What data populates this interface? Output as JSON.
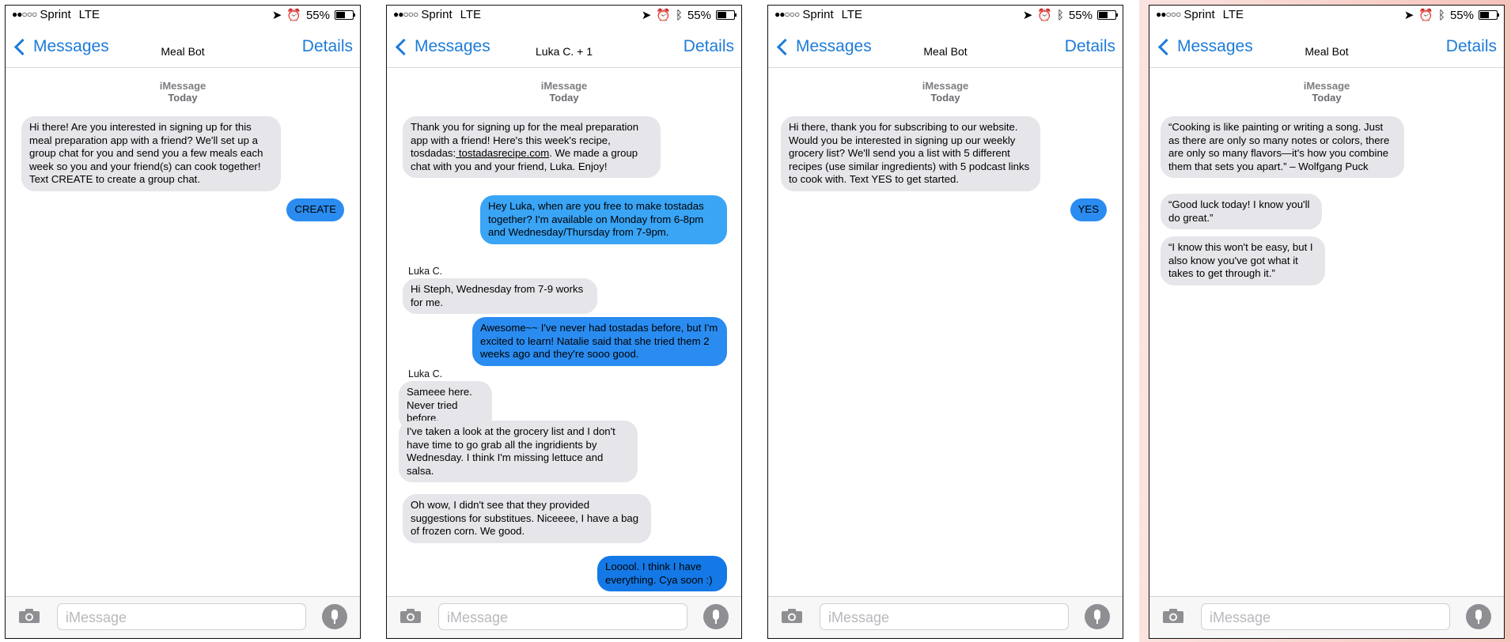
{
  "status": {
    "carrier": "Sprint",
    "network": "LTE",
    "battery": "55%"
  },
  "common": {
    "back_label": "Messages",
    "details_label": "Details",
    "service": "iMessage",
    "day": "Today",
    "input_placeholder": "iMessage"
  },
  "phones": [
    {
      "title": "Meal Bot",
      "messages": [
        {
          "text": "Hi there! Are you interested in signing up for this meal preparation app with a friend? We'll set up a group chat for you and send you a few meals each week so you and your friend(s) can cook together! Text CREATE to create a group chat."
        },
        {
          "text": "CREATE"
        }
      ]
    },
    {
      "title": "Luka C. + 1",
      "messages": [
        {
          "text_before": "Thank you for signing up for the meal preparation app with a friend! Here's this week's recipe, tosdadas:",
          "link": " tostadasrecipe.com",
          "text_after": ". We made a group chat with you and your friend, Luka. Enjoy!"
        },
        {
          "text": "Hey Luka, when are you free to make tostadas together? I'm available on Monday from 6-8pm and Wednesday/Thursday from 7-9pm."
        },
        {
          "sender": "Luka C.",
          "text": "Hi Steph, Wednesday from 7-9 works for me."
        },
        {
          "text": "Awesome~~ I've never had tostadas before, but I'm excited to learn! Natalie said that she tried them 2 weeks ago and they're sooo good."
        },
        {
          "sender": "Luka C.",
          "text": "Sameee here. Never tried before."
        },
        {
          "text": "I've taken a look at the grocery list and I don't have time to go grab all the ingridients by Wednesday. I think I'm missing lettuce and salsa."
        },
        {
          "text": "Oh wow, I didn't see that they provided suggestions for substitues. Niceeee, I have a bag of frozen corn. We good."
        },
        {
          "text": "Looool. I think I have everything. Cya soon :)"
        }
      ]
    },
    {
      "title": "Meal Bot",
      "messages": [
        {
          "text": "Hi there, thank you for subscribing to our website. Would you be interested in signing up our weekly grocery list? We'll send you a list with 5 different recipes (use similar ingredients) with 5 podcast links to cook with. Text YES to get started."
        },
        {
          "text": "YES"
        }
      ]
    },
    {
      "title": "Meal Bot",
      "messages": [
        {
          "text": "“Cooking is like painting or writing a song. Just as there are only so many notes or colors, there are only so many flavors—it's how you combine them that sets you apart.” – Wolfgang Puck"
        },
        {
          "text": "“Good luck today! I know you'll do great.”"
        },
        {
          "text": "“I know this won't be easy, but I also know you've got what it takes to get through it.”"
        }
      ]
    }
  ],
  "colors": {
    "link_blue": "#1d7bd8",
    "bubble_out": "#2a8cf0",
    "bubble_in": "#e5e5ea"
  },
  "icons": [
    "location-arrow-icon",
    "alarm-icon",
    "bluetooth-icon",
    "battery-icon",
    "chevron-left-icon",
    "camera-icon",
    "microphone-icon"
  ]
}
